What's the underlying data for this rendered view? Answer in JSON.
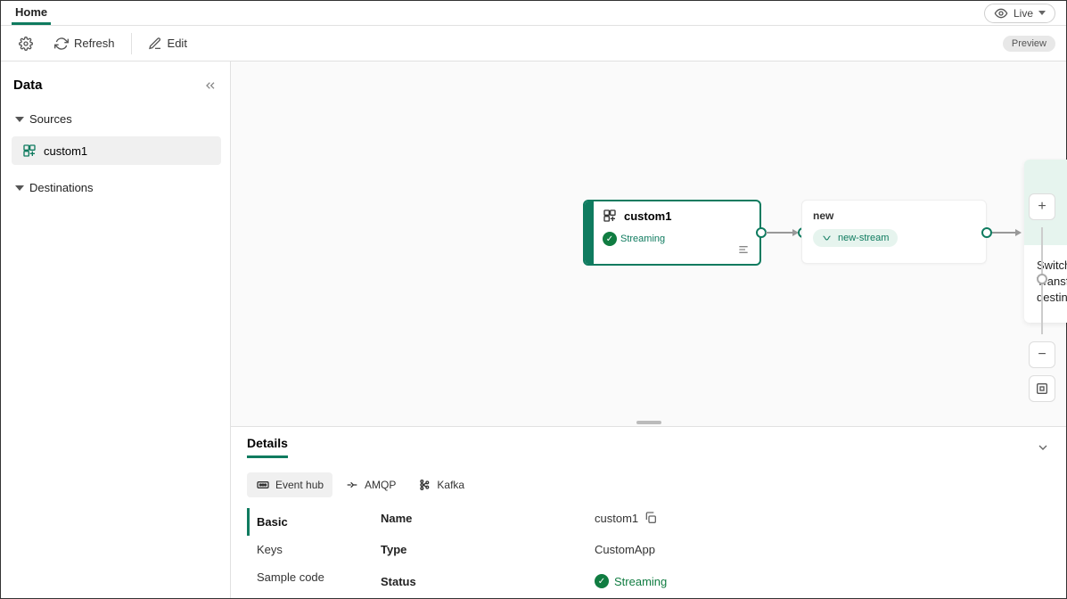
{
  "tabs": {
    "home": "Home"
  },
  "topbar": {
    "live": "Live"
  },
  "toolbar": {
    "refresh": "Refresh",
    "edit": "Edit",
    "preview": "Preview"
  },
  "sidebar": {
    "title": "Data",
    "groups": {
      "sources": "Sources",
      "destinations": "Destinations"
    },
    "items": {
      "custom1": "custom1"
    }
  },
  "canvas": {
    "source": {
      "title": "custom1",
      "status": "Streaming"
    },
    "stream_node": {
      "title": "new",
      "pill": "new-stream"
    },
    "dest_hint": {
      "separator": "/",
      "message": "Switch to edit mode to Transform event or add destination"
    }
  },
  "details": {
    "title": "Details",
    "proto_tabs": {
      "eventhub": "Event hub",
      "amqp": "AMQP",
      "kafka": "Kafka"
    },
    "side_tabs": {
      "basic": "Basic",
      "keys": "Keys",
      "sample": "Sample code"
    },
    "props": {
      "name_label": "Name",
      "name_value": "custom1",
      "type_label": "Type",
      "type_value": "CustomApp",
      "status_label": "Status",
      "status_value": "Streaming"
    }
  }
}
